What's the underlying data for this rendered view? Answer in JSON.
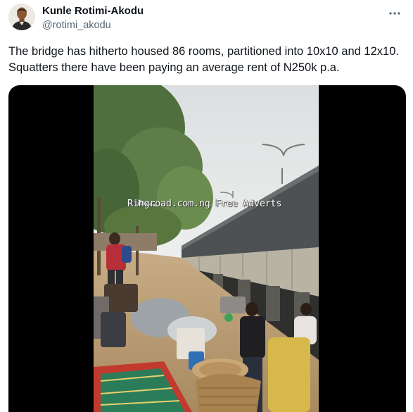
{
  "author": {
    "display_name": "Kunle Rotimi-Akodu",
    "handle": "@rotimi_akodu"
  },
  "tweet": {
    "text": "The bridge has hitherto housed 86 rooms, partitioned into 10x10 and 12x10. Squatters there have been paying an average rent of N250k p.a."
  },
  "media": {
    "watermark": "Ringroad.com.ng Free Adverts"
  },
  "icons": {
    "more": "more-horizontal-icon"
  },
  "colors": {
    "text_primary": "#0f1419",
    "text_secondary": "#536471",
    "media_background": "#000000"
  }
}
